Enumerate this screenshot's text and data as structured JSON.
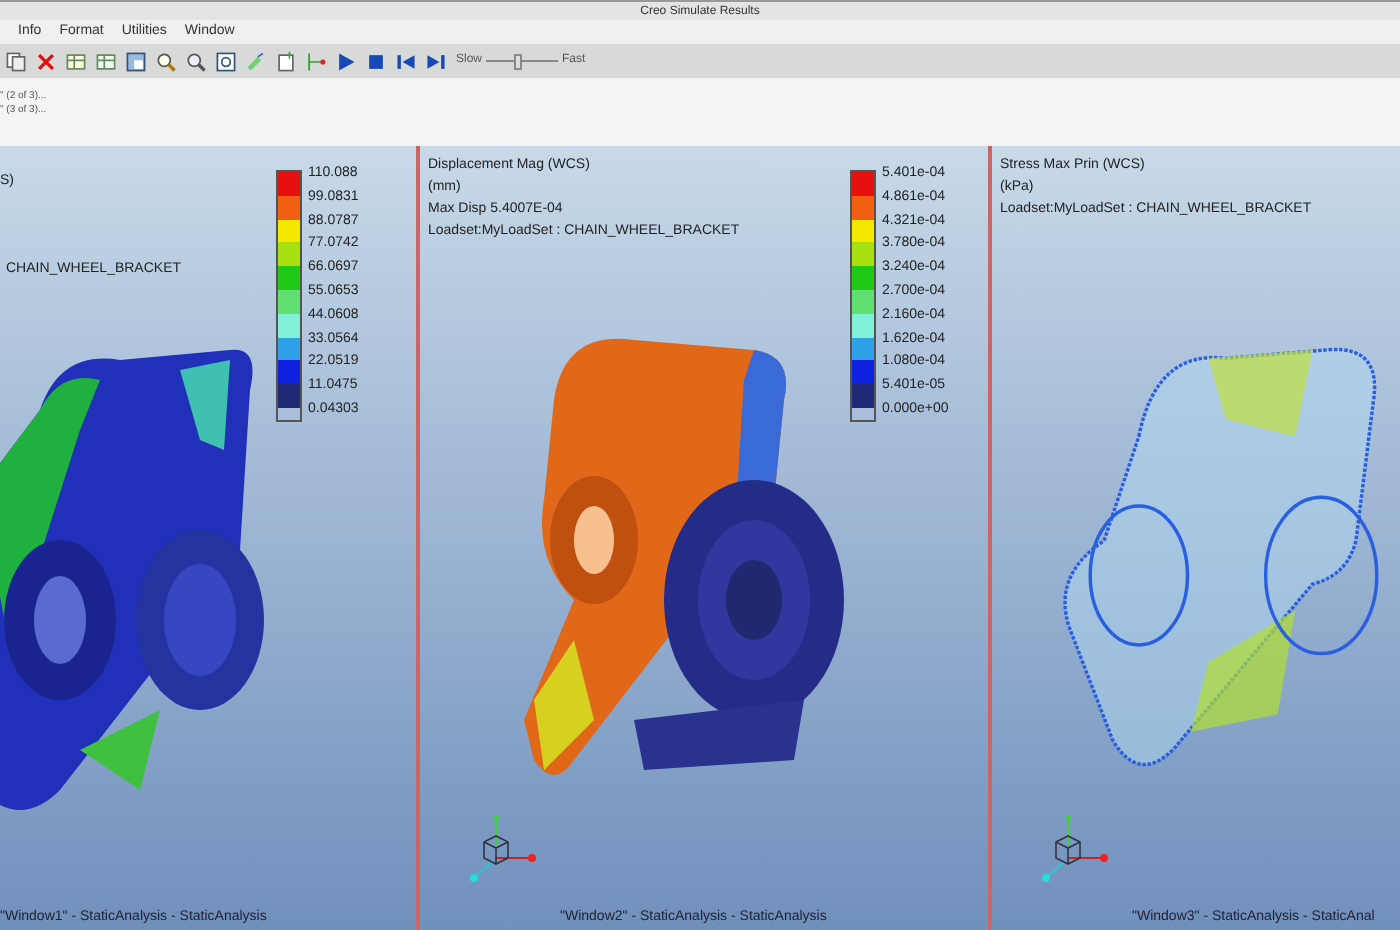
{
  "window": {
    "title": "Creo Simulate Results"
  },
  "menu": [
    "Info",
    "Format",
    "Utilities",
    "Window"
  ],
  "player": {
    "slow_label": "Slow",
    "fast_label": "Fast",
    "level": 0.45
  },
  "info_lines": [
    "\" (2 of 3)...",
    "\" (3 of 3)..."
  ],
  "panels": [
    {
      "kind": "stress",
      "heading": [
        "S)"
      ],
      "model_label": "CHAIN_WHEEL_BRACKET",
      "legend_values": [
        "110.088",
        "99.0831",
        "88.0787",
        "77.0742",
        "66.0697",
        "55.0653",
        "44.0608",
        "33.0564",
        "22.0519",
        "11.0475",
        "0.04303"
      ],
      "footer": "\"Window1\" - StaticAnalysis - StaticAnalysis"
    },
    {
      "kind": "displacement",
      "heading": [
        "Displacement Mag (WCS)",
        "(mm)",
        "Max Disp  5.4007E-04",
        "Loadset:MyLoadSet :  CHAIN_WHEEL_BRACKET"
      ],
      "legend_values": [
        "5.401e-04",
        "4.861e-04",
        "4.321e-04",
        "3.780e-04",
        "3.240e-04",
        "2.700e-04",
        "2.160e-04",
        "1.620e-04",
        "1.080e-04",
        "5.401e-05",
        "0.000e+00"
      ],
      "footer": "\"Window2\" - StaticAnalysis - StaticAnalysis"
    },
    {
      "kind": "wireframe",
      "heading": [
        "Stress Max Prin (WCS)",
        "(kPa)",
        "Loadset:MyLoadSet :  CHAIN_WHEEL_BRACKET"
      ],
      "footer": "\"Window3\" - StaticAnalysis - StaticAnal"
    }
  ],
  "legend_swatches": [
    {
      "color": "#e8100f"
    },
    {
      "color": "#f06010"
    },
    {
      "color": "#f4e800"
    },
    {
      "color": "#a8e010"
    },
    {
      "color": "#20c818"
    },
    {
      "color": "#60e070"
    },
    {
      "color": "#80f0d8"
    },
    {
      "color": "#30a0e8"
    },
    {
      "color": "#1020e0"
    },
    {
      "color": "#202878"
    }
  ]
}
